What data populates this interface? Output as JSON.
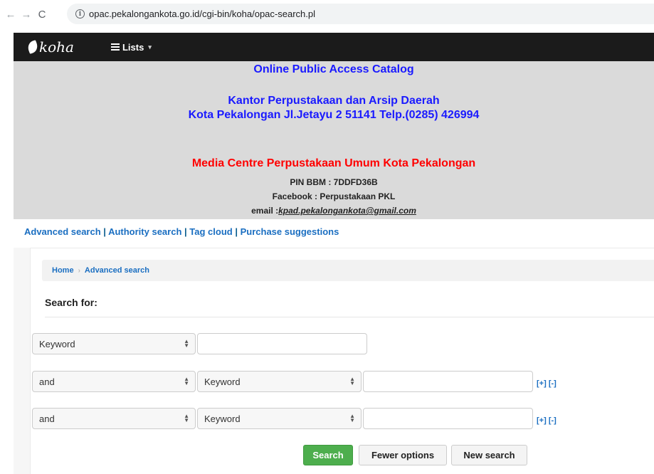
{
  "browser": {
    "back_icon": "←",
    "forward_icon": "→",
    "reload_icon": "C",
    "url": "opac.pekalongankota.go.id/cgi-bin/koha/opac-search.pl"
  },
  "navbar": {
    "logo_text": "koha",
    "lists_label": "Lists",
    "caret": "▾"
  },
  "banner": {
    "catalog_title": "Online Public Access Catalog",
    "office_line1": "Kantor Perpustakaan dan Arsip Daerah",
    "office_line2": "Kota Pekalongan Jl.Jetayu 2 51141 Telp.(0285) 426994",
    "media_centre": "Media Centre Perpustakaan Umum Kota Pekalongan",
    "pin_bbm": "PIN BBM : 7DDFD36B",
    "facebook": "Facebook : Perpustakaan PKL",
    "email_prefix": "email :",
    "email_address": "kpad.pekalongankota@gmail.com"
  },
  "links": {
    "advanced_search": "Advanced search",
    "authority_search": "Authority search",
    "tag_cloud": "Tag cloud",
    "purchase_suggestions": "Purchase suggestions",
    "separator": "|"
  },
  "breadcrumb": {
    "home": "Home",
    "separator": "›",
    "current": "Advanced search"
  },
  "search": {
    "heading": "Search for:",
    "rows": [
      {
        "index": "Keyword",
        "value": ""
      },
      {
        "operator": "and",
        "index": "Keyword",
        "value": ""
      },
      {
        "operator": "and",
        "index": "Keyword",
        "value": ""
      }
    ],
    "add_label": "[+]",
    "remove_label": "[-]"
  },
  "buttons": {
    "search": "Search",
    "fewer_options": "Fewer options",
    "new_search": "New search"
  }
}
